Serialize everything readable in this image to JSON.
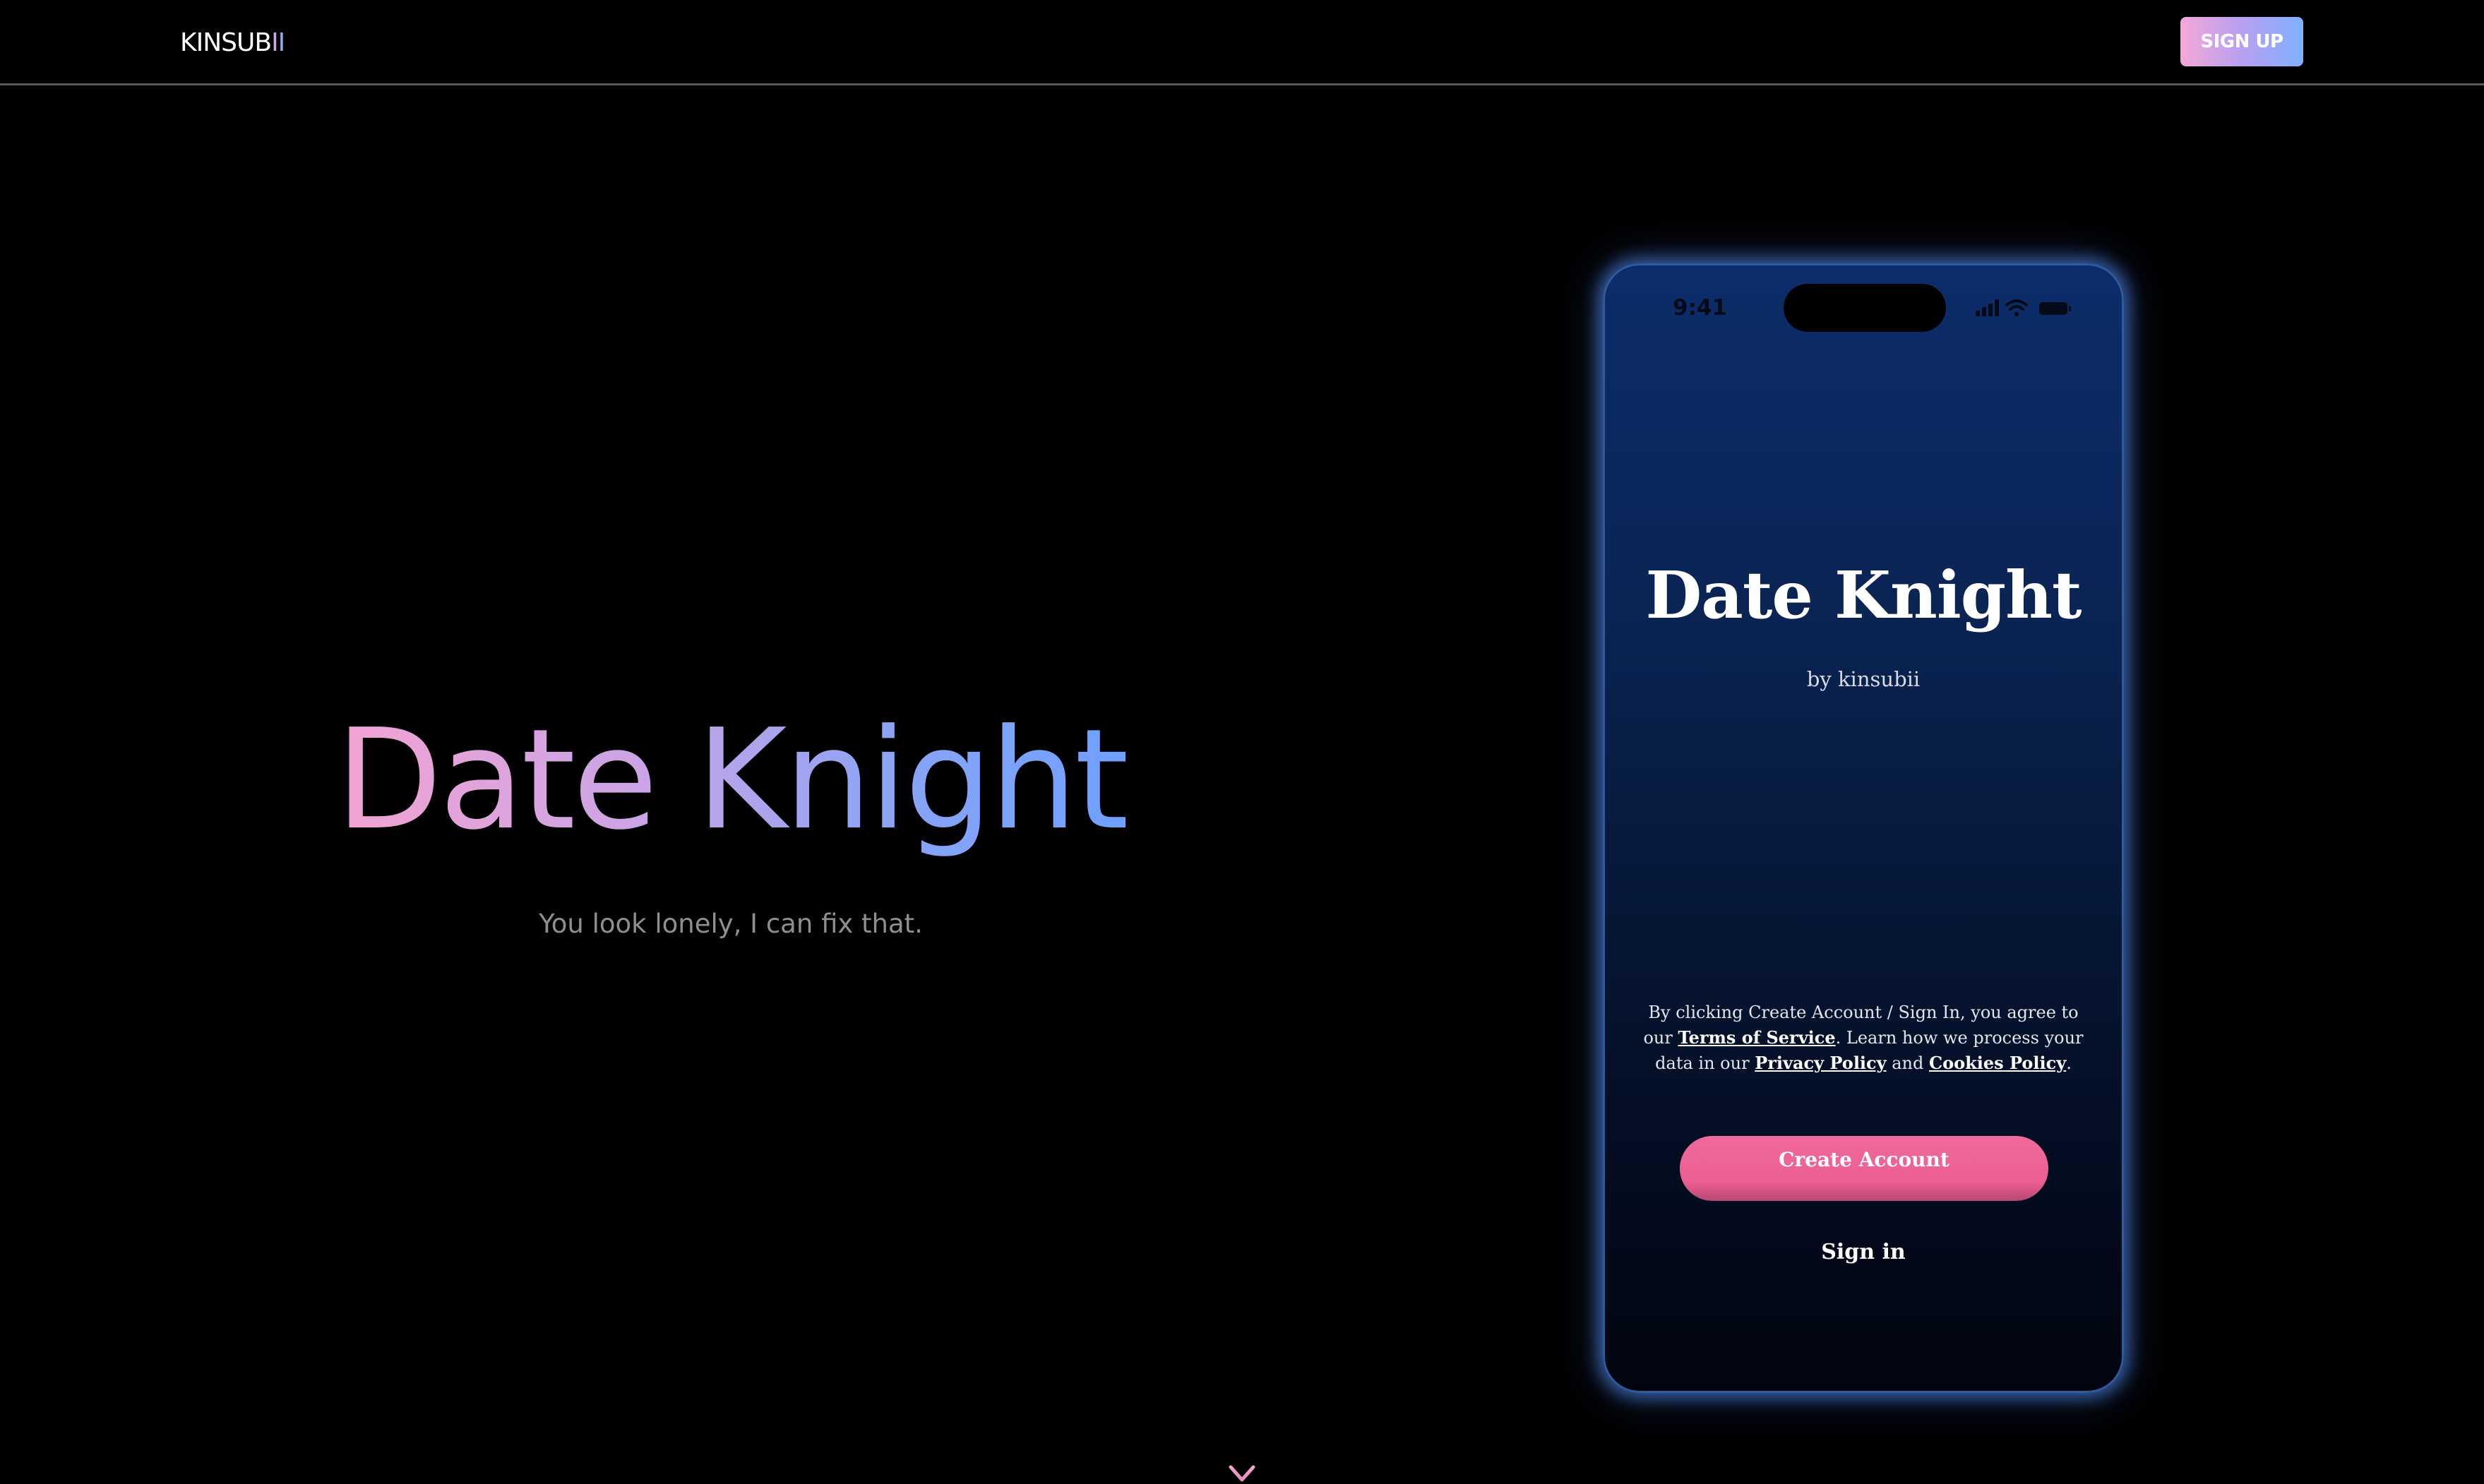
{
  "header": {
    "logo_main": "KINSUB",
    "logo_accent": "II",
    "signup_label": "SIGN UP"
  },
  "hero": {
    "title": "Date Knight",
    "subtitle": "You look lonely, I can fix that.",
    "scroll_icon": "arrow-down-icon"
  },
  "phone": {
    "status_time": "9:41",
    "status_icons": [
      "signal-icon",
      "wifi-icon",
      "battery-icon"
    ],
    "app_title": "Date Knight",
    "app_byline": "by kinsubii",
    "legal": {
      "part1": "By clicking Create Account / Sign In, you agree to our ",
      "terms_label": "Terms of Service",
      "part2": ". Learn how we process your data in our ",
      "privacy_label": "Privacy Policy",
      "part3": " and ",
      "cookies_label": "Cookies Policy",
      "part4": "."
    },
    "create_account_label": "Create Account",
    "signin_label": "Sign in"
  },
  "colors": {
    "background": "#000000",
    "gradient_pink": "#f3a3d2",
    "gradient_blue": "#6ea0ff",
    "phone_glow": "#5694ff",
    "button_pink": "#f06a9a"
  }
}
